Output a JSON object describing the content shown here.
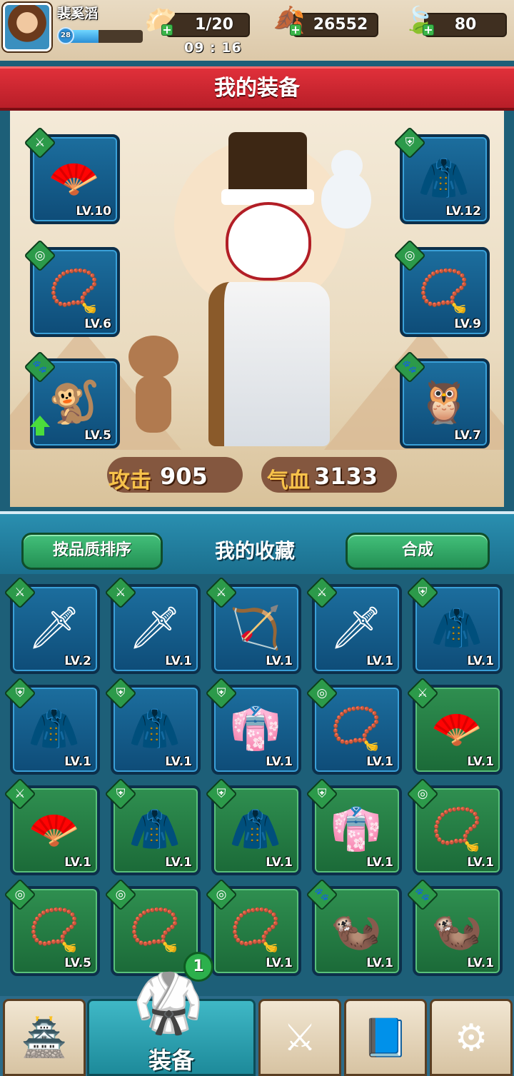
{
  "player": {
    "name": "裴奚滔",
    "level": "28",
    "xp_fraction": 0.4
  },
  "resources": {
    "stamina": {
      "value": "1/20",
      "icon": "bun-icon"
    },
    "gold": {
      "value": "26552",
      "icon": "gold-leaf-icon"
    },
    "jade": {
      "value": "80",
      "icon": "jade-leaf-icon"
    }
  },
  "timer": "09 : 16",
  "equipment": {
    "title": "我的装备",
    "slots": [
      {
        "id": "weapon",
        "category": "weapon",
        "art": "🪭",
        "level": "LV.10",
        "color": "blue"
      },
      {
        "id": "armor",
        "category": "armor",
        "art": "🧥",
        "level": "LV.12",
        "color": "blue"
      },
      {
        "id": "amulet",
        "category": "amulet",
        "art": "📿",
        "level": "LV.6",
        "color": "blue"
      },
      {
        "id": "amulet2",
        "category": "amulet",
        "art": "📿",
        "level": "LV.9",
        "color": "blue"
      },
      {
        "id": "pet",
        "category": "pet",
        "art": "🐒",
        "level": "LV.5",
        "color": "blue",
        "upgrade": true
      },
      {
        "id": "pet2",
        "category": "pet",
        "art": "🦉",
        "level": "LV.7",
        "color": "blue"
      }
    ],
    "stats": {
      "attack_label": "攻击",
      "attack_value": "905",
      "hp_label": "气血",
      "hp_value": "3133"
    }
  },
  "collection": {
    "sort_button": "按品质排序",
    "title": "我的收藏",
    "combine_button": "合成",
    "items": [
      {
        "category": "weapon",
        "art": "🗡",
        "level": "LV.2",
        "color": "blue"
      },
      {
        "category": "weapon",
        "art": "🗡",
        "level": "LV.1",
        "color": "blue"
      },
      {
        "category": "weapon",
        "art": "🏹",
        "level": "LV.1",
        "color": "blue"
      },
      {
        "category": "weapon",
        "art": "🗡",
        "level": "LV.1",
        "color": "blue"
      },
      {
        "category": "armor",
        "art": "🧥",
        "level": "LV.1",
        "color": "blue"
      },
      {
        "category": "armor",
        "art": "🧥",
        "level": "LV.1",
        "color": "blue"
      },
      {
        "category": "armor",
        "art": "🧥",
        "level": "LV.1",
        "color": "blue"
      },
      {
        "category": "armor",
        "art": "👘",
        "level": "LV.1",
        "color": "blue"
      },
      {
        "category": "amulet",
        "art": "📿",
        "level": "LV.1",
        "color": "blue"
      },
      {
        "category": "weapon",
        "art": "🪭",
        "level": "LV.1",
        "color": "green"
      },
      {
        "category": "weapon",
        "art": "🪭",
        "level": "LV.1",
        "color": "green"
      },
      {
        "category": "armor",
        "art": "🧥",
        "level": "LV.1",
        "color": "green"
      },
      {
        "category": "armor",
        "art": "🧥",
        "level": "LV.1",
        "color": "green"
      },
      {
        "category": "armor",
        "art": "👘",
        "level": "LV.1",
        "color": "green"
      },
      {
        "category": "amulet",
        "art": "📿",
        "level": "LV.1",
        "color": "green"
      },
      {
        "category": "amulet",
        "art": "📿",
        "level": "LV.5",
        "color": "green"
      },
      {
        "category": "amulet",
        "art": "📿",
        "level": "",
        "color": "green"
      },
      {
        "category": "amulet",
        "art": "📿",
        "level": "LV.1",
        "color": "green"
      },
      {
        "category": "pet",
        "art": "🦦",
        "level": "LV.1",
        "color": "green"
      },
      {
        "category": "pet",
        "art": "🦦",
        "level": "LV.1",
        "color": "green"
      }
    ]
  },
  "nav": {
    "tabs": [
      {
        "id": "shop",
        "icon": "treasure-shop-icon",
        "art": "🏯"
      },
      {
        "id": "equipment",
        "icon": "armor-icon",
        "label": "装备",
        "active": true
      },
      {
        "id": "weapons",
        "icon": "weapon-forge-icon",
        "art": "⚔"
      },
      {
        "id": "book",
        "icon": "book-icon",
        "art": "📘"
      },
      {
        "id": "settings",
        "icon": "gear-icon",
        "art": "⚙"
      }
    ],
    "active_label": "装备",
    "badge": "1"
  }
}
